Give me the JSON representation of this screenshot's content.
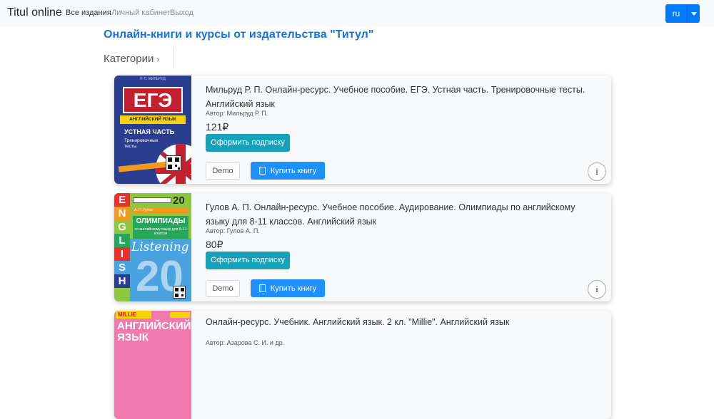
{
  "navbar": {
    "brand": "Titul online",
    "links": [
      "Все издания",
      "Личный кабинет",
      "Выход"
    ],
    "language": "ru"
  },
  "headline": "Онлайн-книги и курсы от издательства \"Титул\"",
  "categories_label": "Категории",
  "books": [
    {
      "title": "Мильруд Р. П. Онлайн-ресурс. Учебное пособие. ЕГЭ. Устная часть. Тренировочные тесты. Английский язык",
      "author": "Автор: Мильруд Р. П.",
      "price": "121₽",
      "subscribe_label": "Оформить подписку",
      "demo_label": "Demo",
      "buy_label": "Купить книгу",
      "info_label": "i",
      "cover": {
        "top": "Р. П. МИЛЬРУД",
        "ege": "ЕГЭ",
        "subject": "АНГЛИЙСКИЙ ЯЗЫК",
        "part": "УСТНАЯ ЧАСТЬ",
        "subtitle_1": "Тренировочные",
        "subtitle_2": "тесты"
      }
    },
    {
      "title": "Гулов А. П. Онлайн-ресурс. Учебное пособие. Аудирование. Олимпиады по английскому языку для 8-11 классов. Английский язык",
      "author": "Автор: Гулов А. П.",
      "price": "80₽",
      "subscribe_label": "Оформить подписку",
      "demo_label": "Demo",
      "buy_label": "Купить книгу",
      "info_label": "i",
      "cover": {
        "letters": [
          "E",
          "N",
          "G",
          "L",
          "I",
          "S",
          "H"
        ],
        "number": "20",
        "author_strip": "А. П. Гулов",
        "olymp": "ОЛИМПИАДЫ",
        "olymp_sub": "по английскому языку для 8–11 классов",
        "listening": "Listening",
        "big_number": "20"
      }
    },
    {
      "title": "Онлайн-ресурс. Учебник. Английский язык. 2 кл. \"Millie\". Английский язык",
      "author": "Автор: Азарова С. И. и др.",
      "cover": {
        "series": "MILLIE",
        "subject_1": "АНГЛИЙСКИЙ",
        "subject_2": "ЯЗЫК"
      }
    }
  ],
  "colors": {
    "navbar_bg": "#f8f9fa",
    "headline": "#1a73d9",
    "subscribe_button": "#17a2b8",
    "buy_button": "#1e90ff",
    "language_button": "#007bff"
  }
}
